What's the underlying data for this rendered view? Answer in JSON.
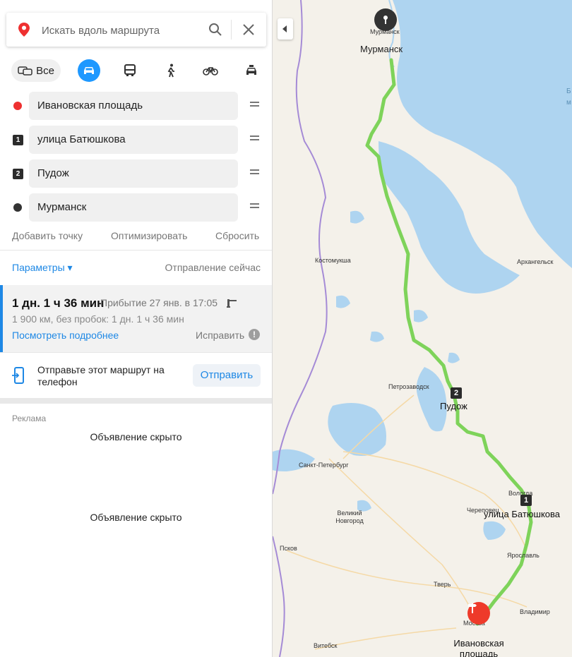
{
  "search": {
    "placeholder": "Искать вдоль маршрута"
  },
  "modes": {
    "all_label": "Все",
    "selected": "car"
  },
  "route_points": [
    {
      "kind": "start",
      "label": "Ивановская площадь",
      "color": "#ee3030"
    },
    {
      "kind": "via",
      "num": "1",
      "label": "улица Батюшкова"
    },
    {
      "kind": "via",
      "num": "2",
      "label": "Пудож"
    },
    {
      "kind": "end",
      "label": "Мурманск",
      "color": "#333333"
    }
  ],
  "actions": {
    "add": "Добавить точку",
    "optimize": "Оптимизировать",
    "reset": "Сбросить"
  },
  "params": {
    "label": "Параметры ▾",
    "departure": "Отправление сейчас"
  },
  "route": {
    "duration": "1 дн. 1 ч 36 мин",
    "arrival": "Прибытие 27 янв. в 17:05",
    "details": "1 900 км, без пробок: 1 дн. 1 ч 36 мин",
    "more": "Посмотреть подробнее",
    "fix": "Исправить"
  },
  "send": {
    "text": "Отправьте этот маршрут на телефон",
    "button": "Отправить"
  },
  "ads": {
    "label": "Реклама",
    "hidden1": "Объявление скрыто",
    "hidden2": "Объявление скрыто"
  },
  "map": {
    "route_color": "#7ed35a",
    "water_color": "#aed4f0",
    "cities": {
      "murmansk_small": "Мурманск",
      "murmansk": "Мурманск",
      "kostomuksha": "Костомукша",
      "arkhangelsk": "Архангельск",
      "petrozavodsk": "Петрозаводск",
      "pudozh": "Пудож",
      "spb": "Санкт-Петербург",
      "vnovgorod": "Великий Новгород",
      "vologda": "Вологда",
      "cherepovets": "Череповец",
      "batyushkova": "улица Батюшкова",
      "pskov": "Псков",
      "yaroslavl": "Ярославль",
      "tver": "Тверь",
      "vladimir": "Владимир",
      "moskva": "Москва",
      "ivanovskaya": "Ивановская площадь",
      "vitebsk": "Витебск"
    },
    "sea_label": "Б",
    "sea_label2": "м",
    "badge1": "1",
    "badge2": "2"
  }
}
